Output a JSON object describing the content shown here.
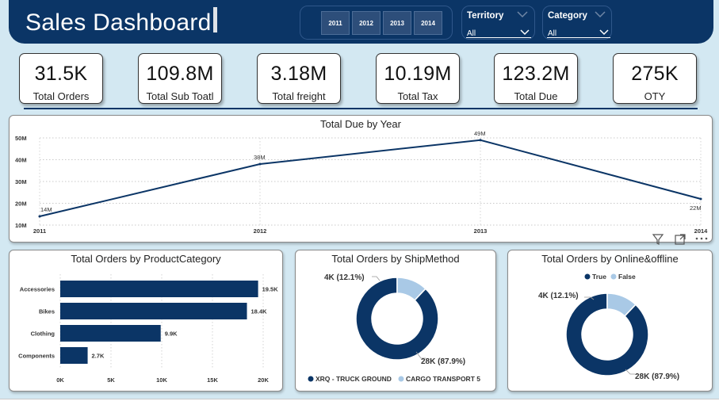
{
  "header": {
    "title": "Sales Dashboard"
  },
  "year_slicer": {
    "years": [
      "2011",
      "2012",
      "2013",
      "2014"
    ]
  },
  "slicers": [
    {
      "label": "Territory",
      "value": "All"
    },
    {
      "label": "Category",
      "value": "All"
    }
  ],
  "kpis": [
    {
      "value": "31.5K",
      "label": "Total Orders"
    },
    {
      "value": "109.8M",
      "label": "Total Sub Toatl"
    },
    {
      "value": "3.18M",
      "label": "Total freight"
    },
    {
      "value": "10.19M",
      "label": "Total Tax"
    },
    {
      "value": "123.2M",
      "label": "Total Due"
    },
    {
      "value": "275K",
      "label": "OTY"
    }
  ],
  "visual_toolbar": {
    "icons": [
      "filter-icon",
      "focus-mode-icon",
      "more-options-icon"
    ]
  },
  "colors": {
    "navy": "#0b3566",
    "light_blue": "#a9c9e6",
    "background": "#d3e8f2"
  },
  "chart_data": [
    {
      "type": "line",
      "title": "Total Due by Year",
      "x": [
        "2011",
        "2012",
        "2013",
        "2014"
      ],
      "values": [
        14,
        38,
        49,
        22
      ],
      "data_labels": [
        "14M",
        "38M",
        "49M",
        "22M"
      ],
      "y_ticks": [
        "10M",
        "20M",
        "30M",
        "40M",
        "50M"
      ],
      "ylim": [
        10,
        50
      ],
      "grid": true
    },
    {
      "type": "bar",
      "orientation": "horizontal",
      "title": "Total Orders by ProductCategory",
      "categories": [
        "Accessories",
        "Bikes",
        "Clothing",
        "Components"
      ],
      "values": [
        19.5,
        18.4,
        9.9,
        2.7
      ],
      "data_labels": [
        "19.5K",
        "18.4K",
        "9.9K",
        "2.7K"
      ],
      "x_ticks": [
        "0K",
        "5K",
        "10K",
        "15K",
        "20K"
      ],
      "xlim": [
        0,
        20
      ]
    },
    {
      "type": "pie",
      "donut": true,
      "title": "Total Orders by ShipMethod",
      "values": [
        87.9,
        12.1
      ],
      "slice_labels": [
        "28K (87.9%)",
        "4K (12.1%)"
      ],
      "legend": [
        "XRQ - TRUCK GROUND",
        "CARGO TRANSPORT 5"
      ],
      "legend_position": "bottom"
    },
    {
      "type": "pie",
      "donut": true,
      "title": "Total Orders by Online&offline",
      "values": [
        87.9,
        12.1
      ],
      "slice_labels": [
        "28K (87.9%)",
        "4K (12.1%)"
      ],
      "legend": [
        "True",
        "False"
      ],
      "legend_position": "top"
    }
  ]
}
